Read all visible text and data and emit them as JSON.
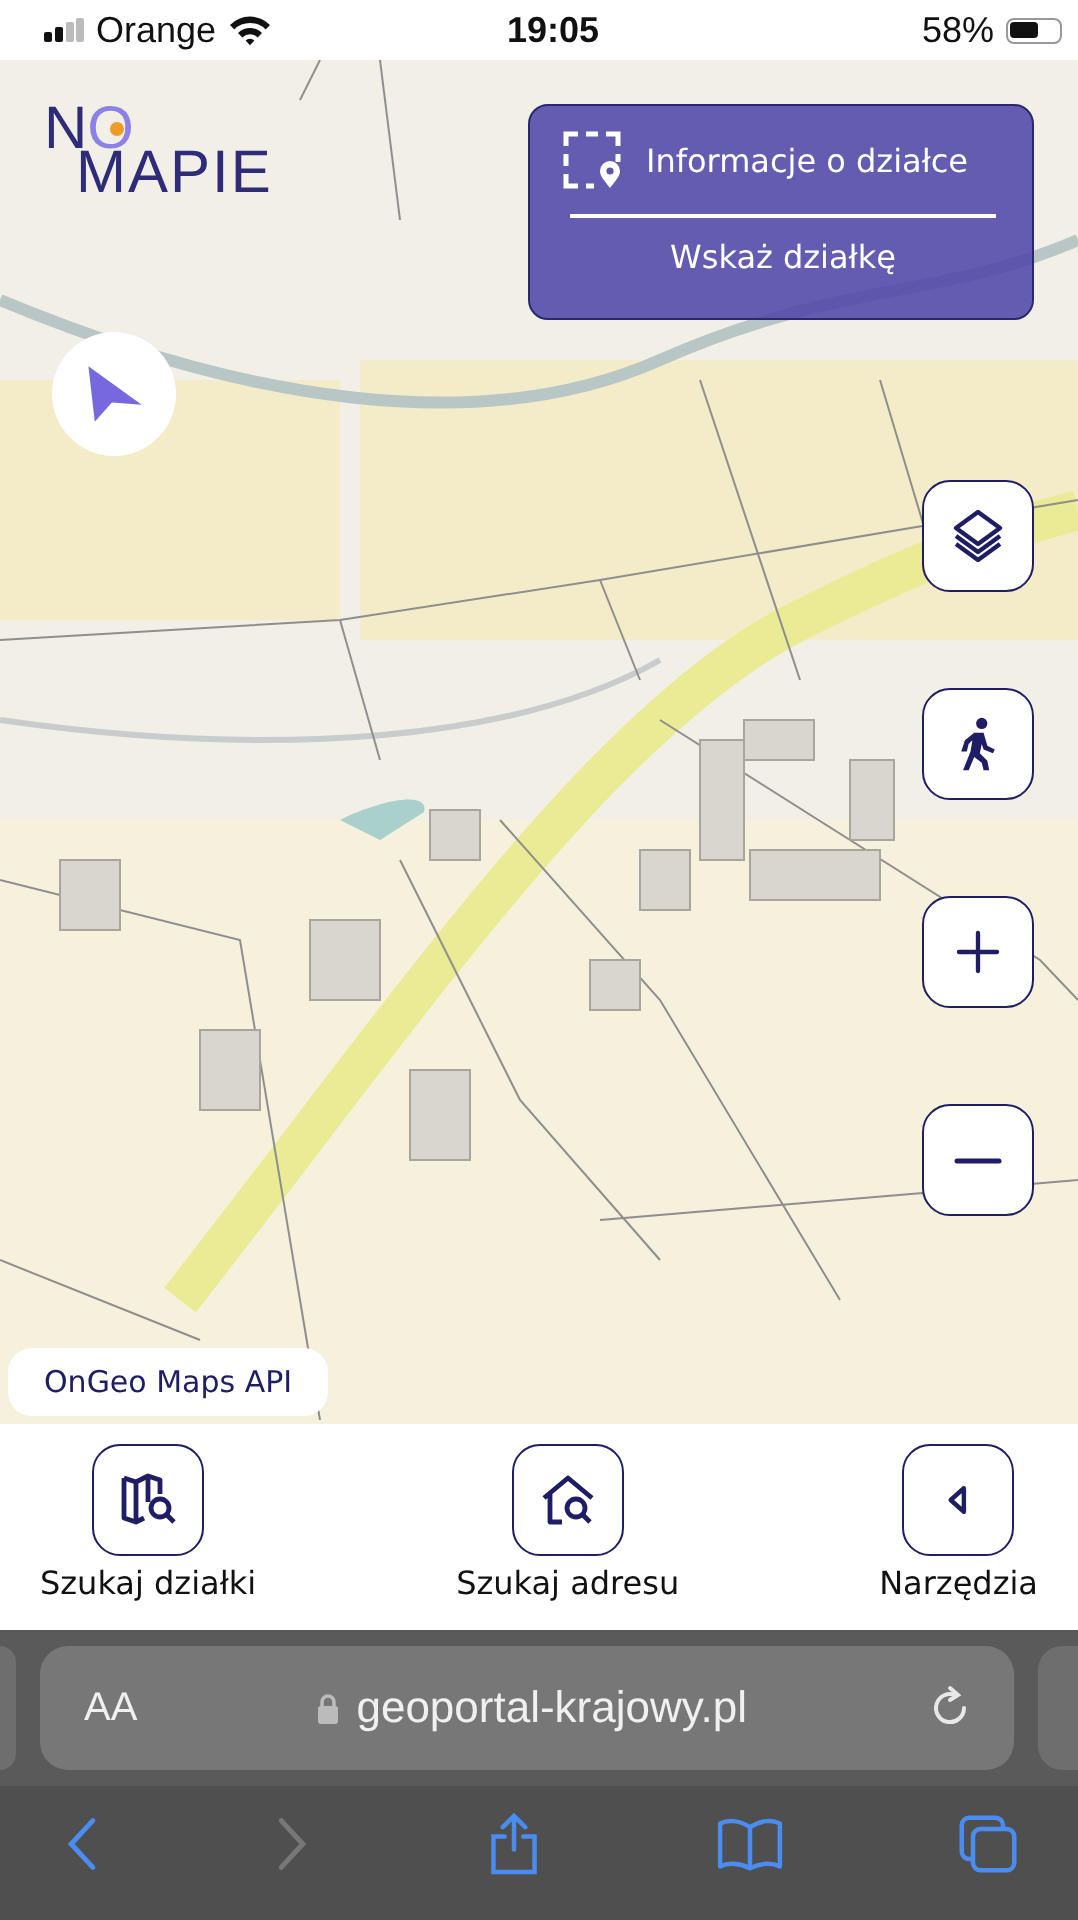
{
  "status_bar": {
    "carrier": "Orange",
    "time": "19:05",
    "battery": "58%"
  },
  "logo": {
    "first": "N",
    "ring": "O",
    "second": "MAPIE"
  },
  "info_panel": {
    "title": "Informacje o działce",
    "action": "Wskaż działkę"
  },
  "map_controls": [
    {
      "kind": "layers"
    },
    {
      "kind": "walker"
    },
    {
      "kind": "zoom-in"
    },
    {
      "kind": "zoom-out"
    }
  ],
  "attribution": "OnGeo Maps API",
  "bottom_nav": [
    {
      "kind": "parcel-search",
      "label": "Szukaj działki"
    },
    {
      "kind": "address-search",
      "label": "Szukaj adresu"
    },
    {
      "kind": "tools",
      "label": "Narzędzia"
    }
  ],
  "browser": {
    "text_size": "AA",
    "url": "geoportal-krajowy.pl",
    "back_disabled": false,
    "forward_disabled": true
  }
}
